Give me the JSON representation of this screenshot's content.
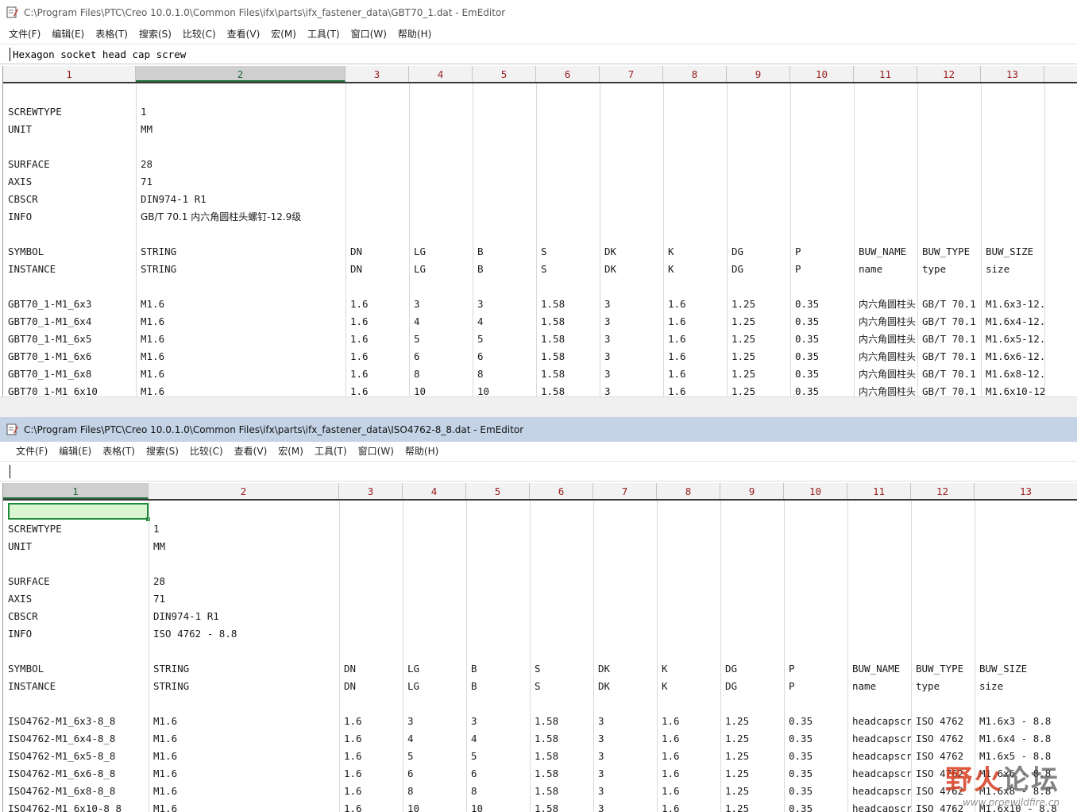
{
  "windows": [
    {
      "title": "C:\\Program Files\\PTC\\Creo 10.0.1.0\\Common Files\\ifx\\parts\\ifx_fastener_data\\GBT70_1.dat - EmEditor",
      "menu": [
        "文件(F)",
        "编辑(E)",
        "表格(T)",
        "搜索(S)",
        "比较(C)",
        "查看(V)",
        "宏(M)",
        "工具(T)",
        "窗口(W)",
        "帮助(H)"
      ],
      "edit_value": "Hexagon socket head cap screw",
      "columns": [
        "1",
        "2",
        "3",
        "4",
        "5",
        "6",
        "7",
        "8",
        "9",
        "10",
        "11",
        "12",
        "13"
      ],
      "active_column": "2",
      "rows": [
        [
          "",
          "",
          "",
          "",
          "",
          "",
          "",
          "",
          "",
          "",
          "",
          "",
          ""
        ],
        [
          "SCREWTYPE",
          "1",
          "",
          "",
          "",
          "",
          "",
          "",
          "",
          "",
          "",
          "",
          ""
        ],
        [
          "UNIT",
          "MM",
          "",
          "",
          "",
          "",
          "",
          "",
          "",
          "",
          "",
          "",
          ""
        ],
        [
          "",
          "",
          "",
          "",
          "",
          "",
          "",
          "",
          "",
          "",
          "",
          "",
          ""
        ],
        [
          "SURFACE",
          "28",
          "",
          "",
          "",
          "",
          "",
          "",
          "",
          "",
          "",
          "",
          ""
        ],
        [
          "AXIS",
          "71",
          "",
          "",
          "",
          "",
          "",
          "",
          "",
          "",
          "",
          "",
          ""
        ],
        [
          "CBSCR",
          "DIN974-1 R1",
          "",
          "",
          "",
          "",
          "",
          "",
          "",
          "",
          "",
          "",
          ""
        ],
        [
          "INFO",
          "GB/T 70.1 内六角圆柱头螺钉-12.9级",
          "",
          "",
          "",
          "",
          "",
          "",
          "",
          "",
          "",
          "",
          ""
        ],
        [
          "",
          "",
          "",
          "",
          "",
          "",
          "",
          "",
          "",
          "",
          "",
          "",
          ""
        ],
        [
          "SYMBOL",
          "STRING",
          "DN",
          "LG",
          "B",
          "S",
          "DK",
          "K",
          "DG",
          "P",
          "BUW_NAME",
          "BUW_TYPE",
          "BUW_SIZE"
        ],
        [
          "INSTANCE",
          "STRING",
          "DN",
          "LG",
          "B",
          "S",
          "DK",
          "K",
          "DG",
          "P",
          "name",
          "type",
          "size"
        ],
        [
          "",
          "",
          "",
          "",
          "",
          "",
          "",
          "",
          "",
          "",
          "",
          "",
          ""
        ],
        [
          "GBT70_1-M1_6x3",
          "M1.6",
          "1.6",
          "3",
          "3",
          "1.58",
          "3",
          "1.6",
          "1.25",
          "0.35",
          "内六角圆柱头",
          "GB/T 70.1",
          "M1.6x3-12."
        ],
        [
          "GBT70_1-M1_6x4",
          "M1.6",
          "1.6",
          "4",
          "4",
          "1.58",
          "3",
          "1.6",
          "1.25",
          "0.35",
          "内六角圆柱头",
          "GB/T 70.1",
          "M1.6x4-12."
        ],
        [
          "GBT70_1-M1_6x5",
          "M1.6",
          "1.6",
          "5",
          "5",
          "1.58",
          "3",
          "1.6",
          "1.25",
          "0.35",
          "内六角圆柱头",
          "GB/T 70.1",
          "M1.6x5-12."
        ],
        [
          "GBT70_1-M1_6x6",
          "M1.6",
          "1.6",
          "6",
          "6",
          "1.58",
          "3",
          "1.6",
          "1.25",
          "0.35",
          "内六角圆柱头",
          "GB/T 70.1",
          "M1.6x6-12."
        ],
        [
          "GBT70_1-M1_6x8",
          "M1.6",
          "1.6",
          "8",
          "8",
          "1.58",
          "3",
          "1.6",
          "1.25",
          "0.35",
          "内六角圆柱头",
          "GB/T 70.1",
          "M1.6x8-12."
        ],
        [
          "GBT70_1-M1_6x10",
          "M1.6",
          "1.6",
          "10",
          "10",
          "1.58",
          "3",
          "1.6",
          "1.25",
          "0.35",
          "内六角圆柱头",
          "GB/T 70.1",
          "M1.6x10-12"
        ]
      ]
    },
    {
      "title": "C:\\Program Files\\PTC\\Creo 10.0.1.0\\Common Files\\ifx\\parts\\ifx_fastener_data\\ISO4762-8_8.dat - EmEditor",
      "menu": [
        "文件(F)",
        "编辑(E)",
        "表格(T)",
        "搜索(S)",
        "比较(C)",
        "查看(V)",
        "宏(M)",
        "工具(T)",
        "窗口(W)",
        "帮助(H)"
      ],
      "edit_value": "",
      "columns": [
        "1",
        "2",
        "3",
        "4",
        "5",
        "6",
        "7",
        "8",
        "9",
        "10",
        "11",
        "12",
        "13"
      ],
      "active_column": "1",
      "rows": [
        [
          "",
          "",
          "",
          "",
          "",
          "",
          "",
          "",
          "",
          "",
          "",
          "",
          ""
        ],
        [
          "SCREWTYPE",
          "1",
          "",
          "",
          "",
          "",
          "",
          "",
          "",
          "",
          "",
          "",
          ""
        ],
        [
          "UNIT",
          "MM",
          "",
          "",
          "",
          "",
          "",
          "",
          "",
          "",
          "",
          "",
          ""
        ],
        [
          "",
          "",
          "",
          "",
          "",
          "",
          "",
          "",
          "",
          "",
          "",
          "",
          ""
        ],
        [
          "SURFACE",
          "28",
          "",
          "",
          "",
          "",
          "",
          "",
          "",
          "",
          "",
          "",
          ""
        ],
        [
          "AXIS",
          "71",
          "",
          "",
          "",
          "",
          "",
          "",
          "",
          "",
          "",
          "",
          ""
        ],
        [
          "CBSCR",
          "DIN974-1 R1",
          "",
          "",
          "",
          "",
          "",
          "",
          "",
          "",
          "",
          "",
          ""
        ],
        [
          "INFO",
          "ISO 4762 - 8.8",
          "",
          "",
          "",
          "",
          "",
          "",
          "",
          "",
          "",
          "",
          ""
        ],
        [
          "",
          "",
          "",
          "",
          "",
          "",
          "",
          "",
          "",
          "",
          "",
          "",
          ""
        ],
        [
          "SYMBOL",
          "STRING",
          "DN",
          "LG",
          "B",
          "S",
          "DK",
          "K",
          "DG",
          "P",
          "BUW_NAME",
          "BUW_TYPE",
          "BUW_SIZE"
        ],
        [
          "INSTANCE",
          "STRING",
          "DN",
          "LG",
          "B",
          "S",
          "DK",
          "K",
          "DG",
          "P",
          "name",
          "type",
          "size"
        ],
        [
          "",
          "",
          "",
          "",
          "",
          "",
          "",
          "",
          "",
          "",
          "",
          "",
          ""
        ],
        [
          "ISO4762-M1_6x3-8_8",
          "M1.6",
          "1.6",
          "3",
          "3",
          "1.58",
          "3",
          "1.6",
          "1.25",
          "0.35",
          "headcapscr",
          "ISO 4762",
          "M1.6x3 - 8.8"
        ],
        [
          "ISO4762-M1_6x4-8_8",
          "M1.6",
          "1.6",
          "4",
          "4",
          "1.58",
          "3",
          "1.6",
          "1.25",
          "0.35",
          "headcapscr",
          "ISO 4762",
          "M1.6x4 - 8.8"
        ],
        [
          "ISO4762-M1_6x5-8_8",
          "M1.6",
          "1.6",
          "5",
          "5",
          "1.58",
          "3",
          "1.6",
          "1.25",
          "0.35",
          "headcapscr",
          "ISO 4762",
          "M1.6x5 - 8.8"
        ],
        [
          "ISO4762-M1_6x6-8_8",
          "M1.6",
          "1.6",
          "6",
          "6",
          "1.58",
          "3",
          "1.6",
          "1.25",
          "0.35",
          "headcapscr",
          "ISO 4762",
          "M1.6x6 - 8.8"
        ],
        [
          "ISO4762-M1_6x8-8_8",
          "M1.6",
          "1.6",
          "8",
          "8",
          "1.58",
          "3",
          "1.6",
          "1.25",
          "0.35",
          "headcapscr",
          "ISO 4762",
          "M1.6x8 - 8.8"
        ],
        [
          "ISO4762-M1_6x10-8_8",
          "M1.6",
          "1.6",
          "10",
          "10",
          "1.58",
          "3",
          "1.6",
          "1.25",
          "0.35",
          "headcapscr",
          "ISO 4762",
          "M1.6x10 - 8.8"
        ]
      ]
    }
  ],
  "watermark": {
    "logo_red": "野火",
    "logo_gray": "论坛",
    "url": "www.proewildfire.cn"
  }
}
